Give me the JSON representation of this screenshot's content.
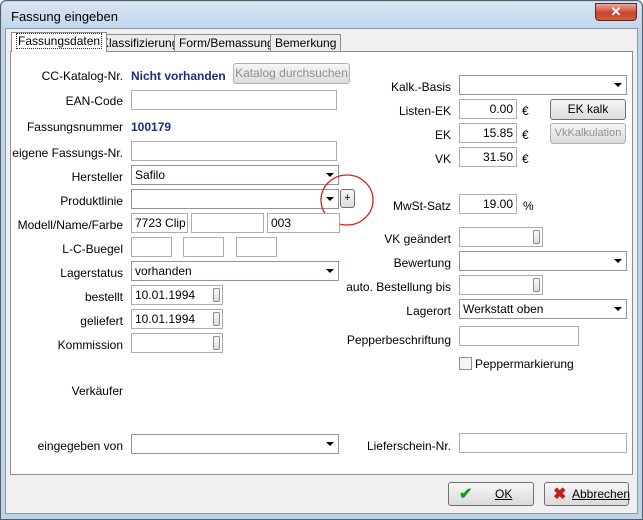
{
  "window": {
    "title": "Fassung eingeben",
    "close_label": "✕"
  },
  "tabs": [
    "Fassungsdaten",
    "Klassifizierung",
    "Form/Bemassung",
    "Bemerkung"
  ],
  "left": {
    "cc_katalog_label": "CC-Katalog-Nr.",
    "cc_katalog_value": "Nicht vorhanden",
    "catalog_button": "Katalog durchsuchen",
    "ean_label": "EAN-Code",
    "ean_value": "",
    "fassungsnummer_label": "Fassungsnummer",
    "fassungsnummer_value": "100179",
    "eigene_label": "eigene Fassungs-Nr.",
    "eigene_value": "",
    "hersteller_label": "Hersteller",
    "hersteller_value": "Safilo",
    "produktlinie_label": "Produktlinie",
    "produktlinie_value": "",
    "plus_label": "+",
    "modell_label": "Modell/Name/Farbe",
    "modell_value": "7723 Clip",
    "name_value": "",
    "farbe_value": "003",
    "lcb_label": "L-C-Buegel",
    "lagerstatus_label": "Lagerstatus",
    "lagerstatus_value": "vorhanden",
    "bestellt_label": "bestellt",
    "bestellt_value": "10.01.1994",
    "geliefert_label": "geliefert",
    "geliefert_value": "10.01.1994",
    "kommission_label": "Kommission",
    "verkaeufer_label": "Verkäufer",
    "eingegeben_label": "eingegeben von"
  },
  "right": {
    "kalk_basis_label": "Kalk.-Basis",
    "listen_ek_label": "Listen-EK",
    "listen_ek_value": "0.00",
    "ek_label": "EK",
    "ek_value": "15.85",
    "vk_label": "VK",
    "vk_value": "31.50",
    "currency": "€",
    "ek_kalk_button": "EK kalk",
    "vk_kalk_button": "VkKalkulation",
    "mwst_label": "MwSt-Satz",
    "mwst_value": "19.00",
    "percent": "%",
    "vk_geaendert_label": "VK geändert",
    "bewertung_label": "Bewertung",
    "auto_bestellung_label": "auto. Bestellung bis",
    "lagerort_label": "Lagerort",
    "lagerort_value": "Werkstatt oben",
    "pepperbeschriftung_label": "Pepperbeschriftung",
    "peppermarkierung_label": "Peppermarkierung",
    "lieferschein_label": "Lieferschein-Nr."
  },
  "footer": {
    "ok_label": "OK",
    "cancel_label": "Abbrechen"
  },
  "colors": {
    "ok_check": "#1a9a1a",
    "cancel_x": "#c0201a",
    "highlight_circle": "#d62020"
  }
}
